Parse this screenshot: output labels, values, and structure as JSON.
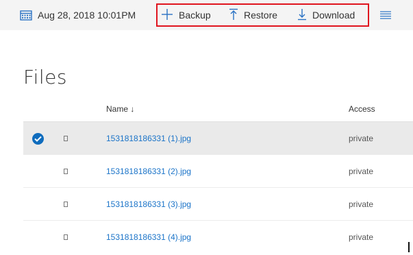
{
  "toolbar": {
    "date": "Aug 28, 2018 10:01PM",
    "backup_label": "Backup",
    "restore_label": "Restore",
    "download_label": "Download",
    "highlight_color": "#e0141e",
    "icons": [
      "calendar-icon",
      "plus-icon",
      "upload-icon",
      "download-icon",
      "list-icon"
    ]
  },
  "page": {
    "title": "Files"
  },
  "table": {
    "columns": {
      "name": "Name ↓",
      "access": "Access"
    },
    "rows": [
      {
        "name": "1531818186331 (1).jpg",
        "access": "private",
        "selected": true
      },
      {
        "name": "1531818186331 (2).jpg",
        "access": "private",
        "selected": false
      },
      {
        "name": "1531818186331 (3).jpg",
        "access": "private",
        "selected": false
      },
      {
        "name": "1531818186331 (4).jpg",
        "access": "private",
        "selected": false
      }
    ]
  },
  "colors": {
    "accent": "#0f6cbd",
    "link": "#1a73c8",
    "selected_row": "#eaeaea"
  }
}
